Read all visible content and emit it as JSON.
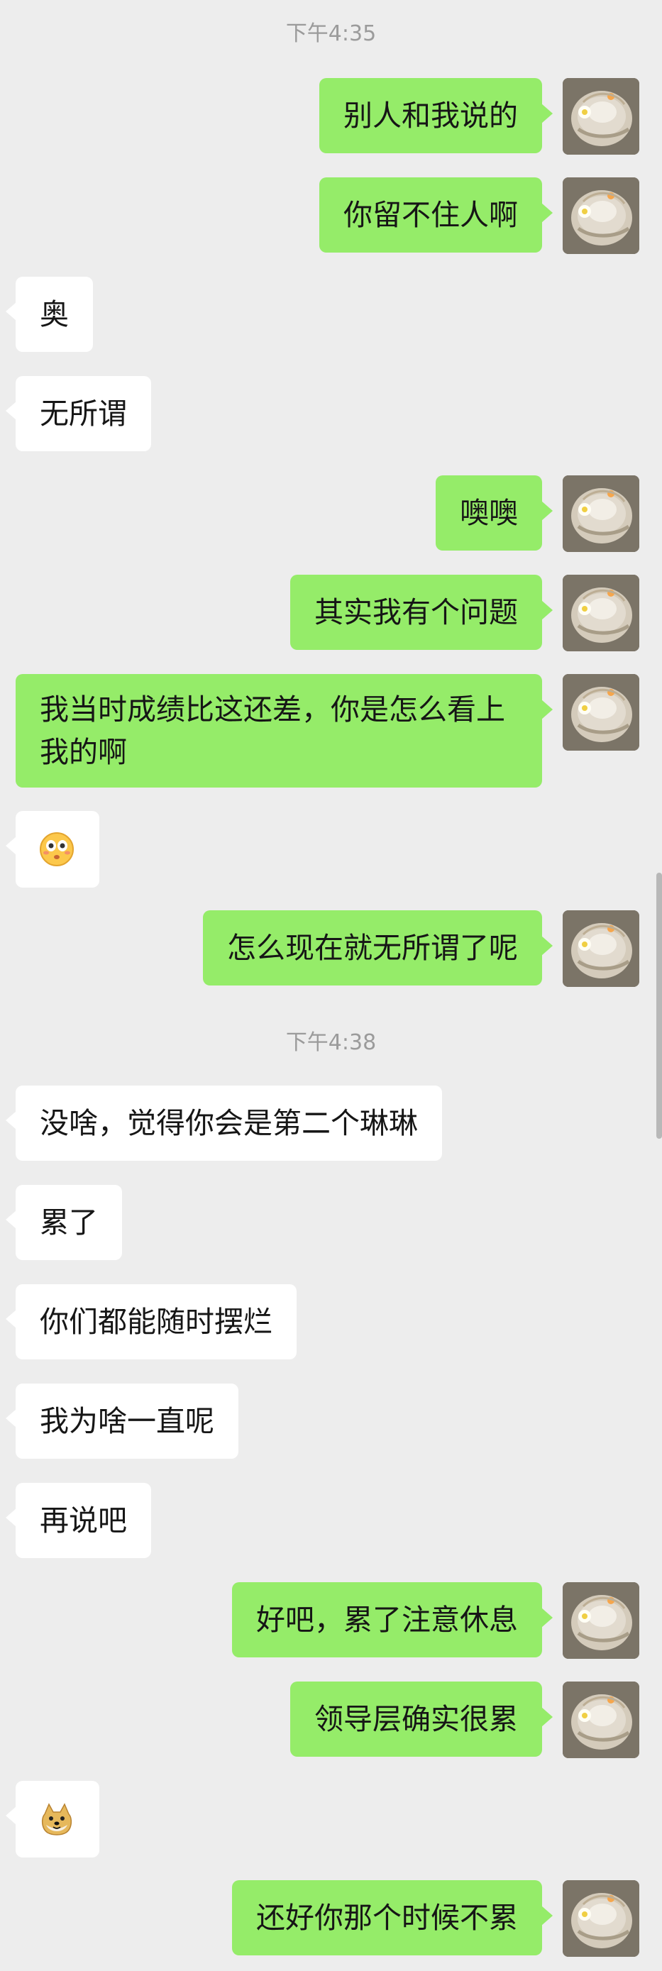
{
  "conversation": {
    "timestamps": [
      "下午4:35",
      "下午4:38"
    ],
    "messages": [
      {
        "id": 1,
        "sender": "me",
        "text": "别人和我说的"
      },
      {
        "id": 2,
        "sender": "me",
        "text": "你留不住人啊"
      },
      {
        "id": 3,
        "sender": "other",
        "text": "奥"
      },
      {
        "id": 4,
        "sender": "other",
        "text": "无所谓"
      },
      {
        "id": 5,
        "sender": "me",
        "text": "噢噢"
      },
      {
        "id": 6,
        "sender": "me",
        "text": "其实我有个问题"
      },
      {
        "id": 7,
        "sender": "me",
        "text": "我当时成绩比这还差，你是怎么看上我的啊"
      },
      {
        "id": 8,
        "sender": "other",
        "type": "emoji",
        "emoji": "flushed-face-icon"
      },
      {
        "id": 9,
        "sender": "me",
        "text": "怎么现在就无所谓了呢"
      },
      {
        "id": 10,
        "sender": "other",
        "text": "没啥，觉得你会是第二个琳琳"
      },
      {
        "id": 11,
        "sender": "other",
        "text": "累了"
      },
      {
        "id": 12,
        "sender": "other",
        "text": "你们都能随时摆烂"
      },
      {
        "id": 13,
        "sender": "other",
        "text": "我为啥一直呢"
      },
      {
        "id": 14,
        "sender": "other",
        "text": "再说吧"
      },
      {
        "id": 15,
        "sender": "me",
        "text": "好吧，累了注意休息"
      },
      {
        "id": 16,
        "sender": "me",
        "text": "领导层确实很累"
      },
      {
        "id": 17,
        "sender": "other",
        "type": "emoji",
        "emoji": "doge-icon"
      },
      {
        "id": 18,
        "sender": "me",
        "text": "还好你那个时候不累"
      }
    ]
  },
  "theme": {
    "background": "#ededed",
    "sent_bubble": "#95ec69",
    "received_bubble": "#ffffff",
    "timestamp_color": "#9b9b9b",
    "text_color": "#161616"
  }
}
